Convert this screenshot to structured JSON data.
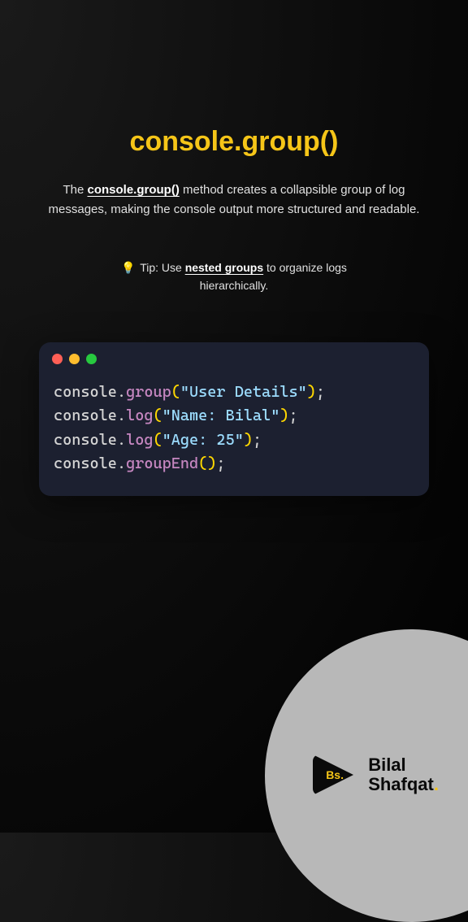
{
  "title": "console.group()",
  "description_prefix": "The ",
  "description_bold": "console.group()",
  "description_suffix": " method creates a collapsible group of log messages, making the console output more structured and readable.",
  "tip_prefix": "Tip: Use ",
  "tip_bold": "nested groups",
  "tip_suffix": " to organize logs hierarchically.",
  "code": {
    "lines": [
      {
        "obj": "console",
        "method": "group",
        "str": "\"User Details\""
      },
      {
        "obj": "console",
        "method": "log",
        "str": "\"Name: Bilal\""
      },
      {
        "obj": "console",
        "method": "log",
        "str": "\"Age: 25\""
      },
      {
        "obj": "console",
        "method": "groupEnd",
        "str": ""
      }
    ]
  },
  "brand": {
    "badge": "Bs.",
    "line1": "Bilal",
    "line2": "Shafqat",
    "dot": "."
  }
}
